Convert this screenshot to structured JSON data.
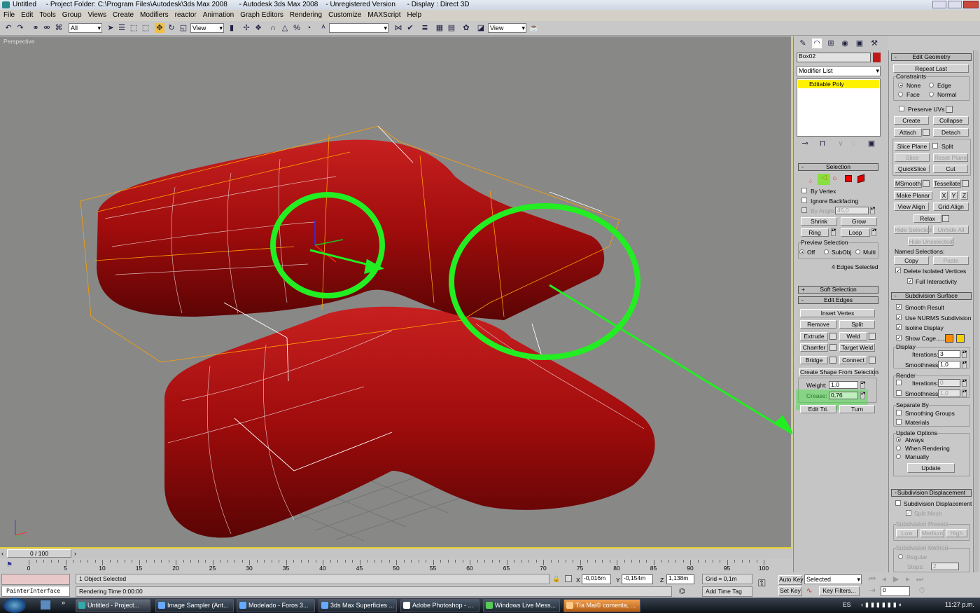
{
  "window": {
    "title": "Untitled     - Project Folder: C:\\Program Files\\Autodesk\\3ds Max 2008      - Autodesk 3ds Max 2008    - Unregistered Version      - Display : Direct 3D"
  },
  "menu": [
    "File",
    "Edit",
    "Tools",
    "Group",
    "Views",
    "Create",
    "Modifiers",
    "reactor",
    "Animation",
    "Graph Editors",
    "Rendering",
    "Customize",
    "MAXScript",
    "Help"
  ],
  "toolbar": {
    "selection_filter": "All",
    "ref_coord": "View",
    "named_sel": "",
    "view2": "View"
  },
  "viewport": {
    "label": "Perspective",
    "colors": {
      "object": "#b01010",
      "highlight": "#20e020",
      "cage": "#ffa000",
      "background": "#888887"
    }
  },
  "command_panel": {
    "object_name": "Box02",
    "object_color": "#c01818",
    "modifier_list": "Modifier List",
    "stack": [
      "Editable Poly"
    ],
    "selection": {
      "title": "Selection",
      "by_vertex": "By Vertex",
      "ignore_backfacing": "Ignore Backfacing",
      "by_angle": "By Angle:",
      "angle": "45,0",
      "shrink": "Shrink",
      "grow": "Grow",
      "ring": "Ring",
      "loop": "Loop",
      "preview": "Preview Selection",
      "off": "Off",
      "subobj": "SubObj",
      "multi": "Multi",
      "status": "4 Edges Selected"
    },
    "soft_selection": "Soft Selection",
    "edit_edges": {
      "title": "Edit Edges",
      "insert_vertex": "Insert Vertex",
      "remove": "Remove",
      "split": "Split",
      "extrude": "Extrude",
      "weld": "Weld",
      "chamfer": "Chamfer",
      "target_weld": "Target Weld",
      "bridge": "Bridge",
      "connect": "Connect",
      "create_shape": "Create Shape From Selection",
      "weight_label": "Weight:",
      "weight": "1,0",
      "crease_label": "Crease:",
      "crease": "0,76",
      "edit_tri": "Edit Tri.",
      "turn": "Turn"
    },
    "edit_geometry": {
      "title": "Edit Geometry",
      "repeat_last": "Repeat Last",
      "constraints": "Constraints",
      "none": "None",
      "edge": "Edge",
      "face": "Face",
      "normal": "Normal",
      "preserve_uvs": "Preserve UVs",
      "create": "Create",
      "collapse": "Collapse",
      "attach": "Attach",
      "detach": "Detach",
      "slice_plane": "Slice Plane",
      "split": "Split",
      "slice": "Slice",
      "reset_plane": "Reset Plane",
      "quickslice": "QuickSlice",
      "cut": "Cut",
      "msmooth": "MSmooth",
      "tessellate": "Tessellate",
      "make_planar": "Make Planar",
      "x": "X",
      "y": "Y",
      "z": "Z",
      "view_align": "View Align",
      "grid_align": "Grid Align",
      "relax": "Relax",
      "hide_selected": "Hide Selected",
      "unhide_all": "Unhide All",
      "hide_unselected": "Hide Unselected",
      "named_selections": "Named Selections:",
      "copy": "Copy",
      "paste": "Paste",
      "delete_isolated": "Delete Isolated Vertices",
      "full_interactivity": "Full Interactivity"
    },
    "subdivision_surface": {
      "title": "Subdivision Surface",
      "smooth_result": "Smooth Result",
      "use_nurms": "Use NURMS Subdivision",
      "isoline": "Isoline Display",
      "show_cage": "Show Cage......",
      "cage_colors": [
        "#ff8c00",
        "#f5d000"
      ],
      "display": "Display",
      "iterations_label": "Iterations:",
      "display_iterations": "3",
      "smoothness_label": "Smoothness:",
      "display_smoothness": "1,0",
      "render": "Render",
      "render_iterations": "0",
      "render_smoothness": "1,0",
      "separate_by": "Separate By",
      "smoothing_groups": "Smoothing Groups",
      "materials": "Materials",
      "update_options": "Update Options",
      "always": "Always",
      "when_rendering": "When Rendering",
      "manually": "Manually",
      "update": "Update"
    },
    "subdivision_displacement": {
      "title": "Subdivision Displacement",
      "enable": "Subdivision Displacement",
      "split_mesh": "Split Mesh",
      "presets": "Subdivision Presets",
      "low": "Low",
      "medium": "Medium",
      "high": "High",
      "method": "Subdivision Method",
      "regular": "Regular",
      "steps_label": "Steps:",
      "steps": "2"
    }
  },
  "timeline": {
    "slider": "0 / 100",
    "labels": [
      "0",
      "5",
      "10",
      "15",
      "20",
      "25",
      "30",
      "35",
      "40",
      "45",
      "50",
      "55",
      "60",
      "65",
      "70",
      "75",
      "80",
      "85",
      "90",
      "95",
      "100"
    ]
  },
  "status": {
    "script_listener": "PainterInterface",
    "selection": "1 Object Selected",
    "prompt": "Rendering Time  0:00:00",
    "x": "-0,016m",
    "y": "-0,154m",
    "z": "1,138m",
    "grid": "Grid = 0,1m",
    "add_time_tag": "Add Time Tag",
    "auto_key": "Auto Key",
    "set_key": "Set Key",
    "key_mode": "Selected",
    "key_filters": "Key Filters...",
    "frame": "0"
  },
  "taskbar": {
    "items": [
      "Untitled     - Project...",
      "Image Sampler (Ant...",
      "Modelado - Foros 3...",
      "3ds Max Superficies ...",
      "Adobe Photoshop - ...",
      "Windows Live Mess...",
      "Tía Mai© comenta, ..."
    ],
    "language": "ES",
    "clock": "11:27 p.m."
  }
}
